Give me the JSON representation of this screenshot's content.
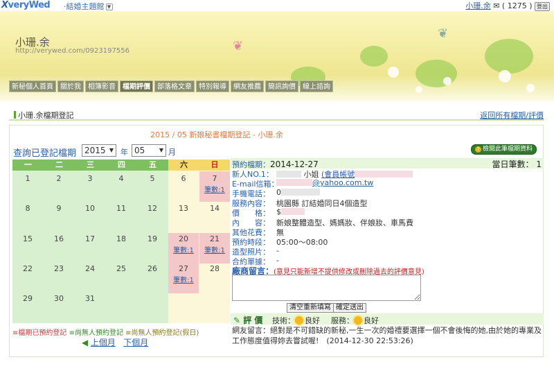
{
  "topbar": {
    "logo_x": "X",
    "logo_rest": "veryWed",
    "theme_label": "·結婚主題館",
    "user_name": "小珊.余",
    "points": "( 1275 )",
    "logout": "登出"
  },
  "banner": {
    "title": "小珊.余",
    "url": "http://verywed.com/0923197556"
  },
  "nav": {
    "items": [
      "新秘個人首頁",
      "關於我",
      "相簿影音",
      "檔期評價",
      "部落格文章",
      "特別報導",
      "網友推薦",
      "簡訊詢價",
      "線上諮詢"
    ]
  },
  "page": {
    "heading": "小珊.余檔期登記",
    "back_link": "返回所有檔期/評價",
    "center_title": "2015 / 05 新娘秘書檔期登記 - 小珊.余"
  },
  "query": {
    "label": "查詢已登記檔期",
    "year": "2015",
    "year_suffix": "年",
    "month": "05",
    "month_suffix": "月"
  },
  "calendar": {
    "weekdays": [
      "一",
      "二",
      "三",
      "四",
      "五",
      "六",
      "日"
    ],
    "weeks": [
      [
        "1",
        "2",
        "3",
        "4",
        "5",
        "6",
        "7"
      ],
      [
        "8",
        "9",
        "10",
        "11",
        "12",
        "13",
        "14"
      ],
      [
        "15",
        "16",
        "17",
        "18",
        "19",
        "20",
        "21"
      ],
      [
        "22",
        "23",
        "24",
        "25",
        "26",
        "27",
        "28"
      ],
      [
        "29",
        "30",
        "31",
        "",
        "",
        "",
        ""
      ]
    ],
    "count_label": "筆數:1"
  },
  "legend": {
    "booked": "≡檔期已預約登記",
    "free": "≡尚無人預約登記",
    "free_holiday": "≡尚無人預約登記(假日)",
    "prev": "上個月",
    "next": "下個月"
  },
  "detail": {
    "button": "檢閱此筆檔期資料",
    "button_icon": "?",
    "date_label": "預約檔期：",
    "date": "2014-12-27",
    "daily_count": "當日筆數： 1",
    "bride_label": "新人NO.1：",
    "bride_suffix": "小姐",
    "account_label": "(會員帳號",
    "email_label": "E-mail信箱：",
    "email_domain": "@yahoo.com.tw",
    "phone_label": "手機電話：",
    "phone_prefix": "0",
    "service_label": "服務內容：",
    "service_value": "桃園縣 訂結婚同日4個造型",
    "price_label": "價　　格：",
    "price_prefix": "$",
    "content_label": "內　　容：",
    "content_value": "新娘整體造型、媽媽妝、伴娘妝、車馬費",
    "other_label": "其他花費：",
    "other_value": "無",
    "time_label": "預約時段：",
    "time_value": "05:00～08:00",
    "photo_label": "造型照片：",
    "photo_value": "-",
    "contract_label": "合約單據：",
    "contract_value": "-"
  },
  "message": {
    "title": "廠商留言：",
    "warning": "(意見只能新增不提供修改或刪除過去的評價意見)",
    "clear": "清空重新填寫",
    "submit": "確定送出"
  },
  "rating": {
    "title": "評 價",
    "skill_label": "技術：",
    "skill_value": "良好",
    "service_label": "服務：",
    "service_value": "良好",
    "review": "網友留言：絕對是不可錯缺的新秘,一生一次的婚禮要選擇一個不會後悔的她,由於她的專業及工作態度值得妳去嘗試喔!",
    "review_time": "(2014-12-30 22:53:26)"
  },
  "colors": {
    "accent_blue": "#2a5fa8",
    "weekday_green": "#7fbf62",
    "weekend_yellow": "#f5d86a",
    "booked_pink": "#f4c8c8",
    "warning_red": "#c02020"
  }
}
